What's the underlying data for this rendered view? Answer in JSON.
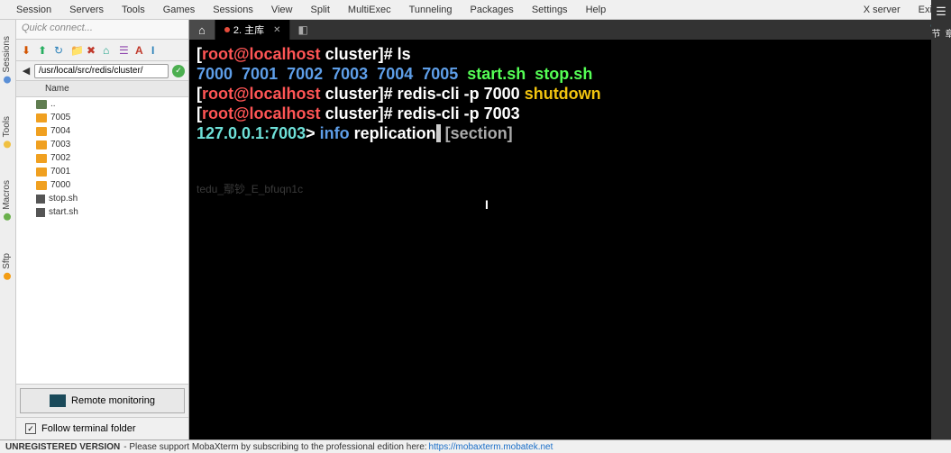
{
  "menubar": {
    "items": [
      "Session",
      "Servers",
      "Tools",
      "Games",
      "Sessions",
      "View",
      "Split",
      "MultiExec",
      "Tunneling",
      "Packages",
      "Settings",
      "Help"
    ],
    "right": [
      "X server",
      "Exit"
    ]
  },
  "quick_connect": "Quick connect...",
  "vert_tabs": [
    "Sessions",
    "Tools",
    "Macros",
    "Sftp"
  ],
  "path": "/usr/local/src/redis/cluster/",
  "file_header": {
    "col1": "",
    "col2": "Name"
  },
  "files": [
    {
      "name": "..",
      "type": "up"
    },
    {
      "name": "7005",
      "type": "folder"
    },
    {
      "name": "7004",
      "type": "folder"
    },
    {
      "name": "7003",
      "type": "folder"
    },
    {
      "name": "7002",
      "type": "folder"
    },
    {
      "name": "7001",
      "type": "folder"
    },
    {
      "name": "7000",
      "type": "folder"
    },
    {
      "name": "stop.sh",
      "type": "file"
    },
    {
      "name": "start.sh",
      "type": "file"
    }
  ],
  "remote_monitor": "Remote monitoring",
  "follow_terminal": "Follow terminal folder",
  "tab": {
    "title": "2. 主库"
  },
  "terminal": {
    "l1_prompt_open": "[",
    "l1_user": "root@localhost",
    "l1_dir": " cluster",
    "l1_prompt_close": "]# ",
    "l1_cmd": "ls",
    "l2_ports": "7000  7001  7002  7003  7004  7005",
    "l2_scripts": "  start.sh  stop.sh",
    "l3_cmd": "redis-cli -p 7000 ",
    "l3_shutdown": "shutdown",
    "l4_cmd": "redis-cli -p 7003",
    "l5_host": "127.0.0.1:",
    "l5_port": "7003",
    "l5_arrow": "> ",
    "l5_info": "info ",
    "l5_repl": "replication",
    "l5_hint": " [section]",
    "watermark": "tedu_鄢钞_E_bfuqn1c"
  },
  "statusbar": {
    "bold": "UNREGISTERED VERSION",
    "text": " - Please support MobaXterm by subscribing to the professional edition here: ",
    "link": "https://mobaxterm.mobatek.net"
  },
  "far_right_label": "章节"
}
